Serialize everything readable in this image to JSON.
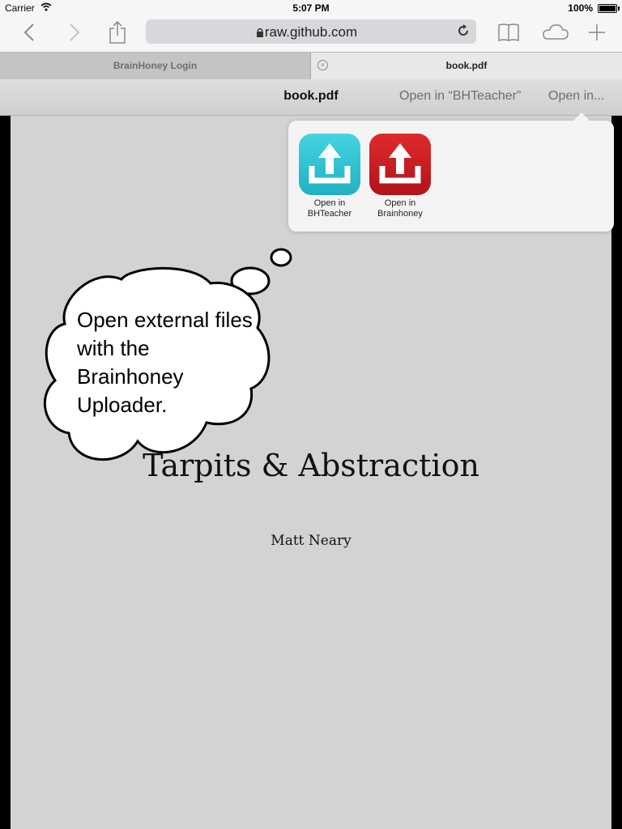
{
  "status": {
    "carrier": "Carrier",
    "time": "5:07 PM",
    "battery": "100%"
  },
  "toolbar": {
    "url": "raw.github.com"
  },
  "tabs": [
    {
      "label": "BrainHoney Login"
    },
    {
      "label": "book.pdf"
    }
  ],
  "pdf_bar": {
    "title": "book.pdf",
    "open_in_app": "Open in “BHTeacher”",
    "open_in": "Open in..."
  },
  "popover": {
    "apps": [
      {
        "line1": "Open in",
        "line2": "BHTeacher",
        "color": "#2fc4d4"
      },
      {
        "line1": "Open in",
        "line2": "Brainhoney",
        "color": "#c9181c"
      }
    ]
  },
  "callout": {
    "text": "Open external files with the Brainhoney Uploader."
  },
  "document": {
    "title": "Tarpits & Abstraction",
    "author": "Matt Neary"
  }
}
